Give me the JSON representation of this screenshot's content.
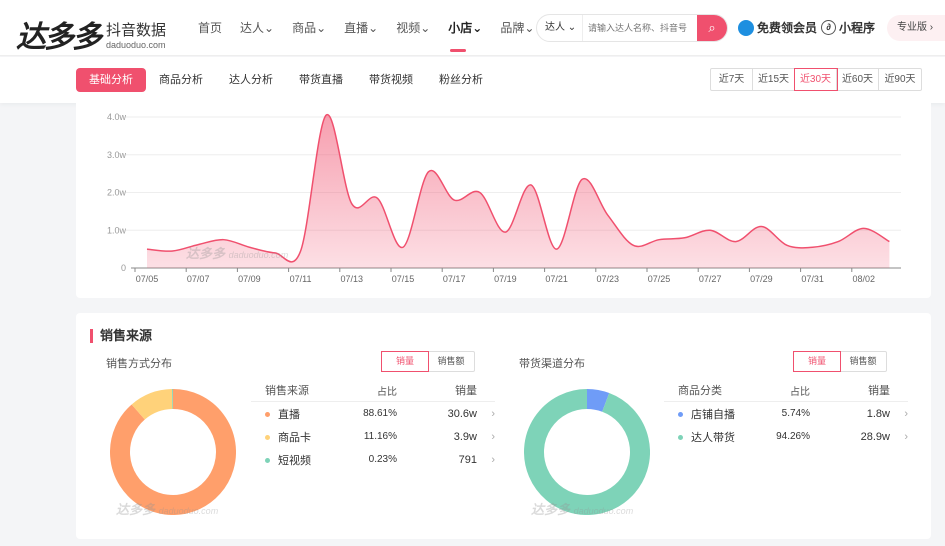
{
  "header": {
    "logo_main": "达多多",
    "logo_sub": "抖音数据",
    "logo_domain": "daduoduo.com",
    "nav": [
      {
        "label": "首页"
      },
      {
        "label": "达人⌄"
      },
      {
        "label": "商品⌄"
      },
      {
        "label": "直播⌄"
      },
      {
        "label": "视频⌄"
      },
      {
        "label": "小店⌄",
        "active": true
      },
      {
        "label": "品牌⌄"
      }
    ],
    "search": {
      "type": "达人 ⌄",
      "placeholder": "请输入达人名称、抖音号"
    },
    "vip": "免费领会员",
    "mini": "小程序",
    "pro": "专业版 ›"
  },
  "subnav": {
    "tabs": [
      "基础分析",
      "商品分析",
      "达人分析",
      "带货直播",
      "带货视频",
      "粉丝分析"
    ],
    "active_tab": 0,
    "ranges": [
      "近7天",
      "近15天",
      "近30天",
      "近60天",
      "近90天"
    ],
    "active_range": 2
  },
  "watermark": {
    "main": "达多多",
    "domain": "daduoduo.com"
  },
  "chart_data": {
    "type": "area",
    "color": "#f0506e",
    "x": [
      "07/05",
      "07/06",
      "07/07",
      "07/08",
      "07/09",
      "07/10",
      "07/11",
      "07/12",
      "07/13",
      "07/14",
      "07/15",
      "07/16",
      "07/17",
      "07/18",
      "07/19",
      "07/20",
      "07/21",
      "07/22",
      "07/23",
      "07/24",
      "07/25",
      "07/26",
      "07/27",
      "07/28",
      "07/29",
      "07/30",
      "07/31",
      "08/01",
      "08/02",
      "08/03"
    ],
    "values": [
      0.5,
      0.45,
      0.62,
      0.75,
      0.55,
      0.4,
      0.45,
      4.05,
      1.7,
      1.85,
      0.55,
      2.55,
      1.8,
      2.0,
      0.95,
      2.2,
      0.5,
      2.35,
      1.4,
      0.6,
      0.75,
      0.8,
      1.0,
      0.7,
      1.1,
      0.6,
      0.55,
      0.7,
      1.05,
      0.7
    ],
    "yunit": "w",
    "ylim": [
      0,
      4
    ],
    "yticks": [
      "0",
      "1.0w",
      "2.0w",
      "3.0w",
      "4.0w"
    ],
    "xticks": [
      "07/05",
      "07/07",
      "07/09",
      "07/11",
      "07/13",
      "07/15",
      "07/17",
      "07/19",
      "07/21",
      "07/23",
      "07/25",
      "07/27",
      "07/29",
      "07/31",
      "08/02"
    ],
    "grid": true
  },
  "sales_source": {
    "title": "销售来源",
    "left": {
      "title": "销售方式分布",
      "toggle": [
        "销量",
        "销售额"
      ],
      "headers": [
        "销售来源",
        "占比",
        "销量"
      ],
      "rows": [
        {
          "name": "直播",
          "pct": "88.61%",
          "value": "30.6w",
          "color": "#ff9f6b",
          "share": 88.61
        },
        {
          "name": "商品卡",
          "pct": "11.16%",
          "value": "3.9w",
          "color": "#ffd27a",
          "share": 11.16
        },
        {
          "name": "短视频",
          "pct": "0.23%",
          "value": "791",
          "color": "#7ed3b8",
          "share": 0.23
        }
      ]
    },
    "right": {
      "title": "带货渠道分布",
      "toggle": [
        "销量",
        "销售额"
      ],
      "headers": [
        "商品分类",
        "占比",
        "销量"
      ],
      "rows": [
        {
          "name": "店铺自播",
          "pct": "5.74%",
          "value": "1.8w",
          "color": "#6f9cf7",
          "share": 5.74
        },
        {
          "name": "达人带货",
          "pct": "94.26%",
          "value": "28.9w",
          "color": "#7ed3b8",
          "share": 94.26
        }
      ]
    }
  }
}
